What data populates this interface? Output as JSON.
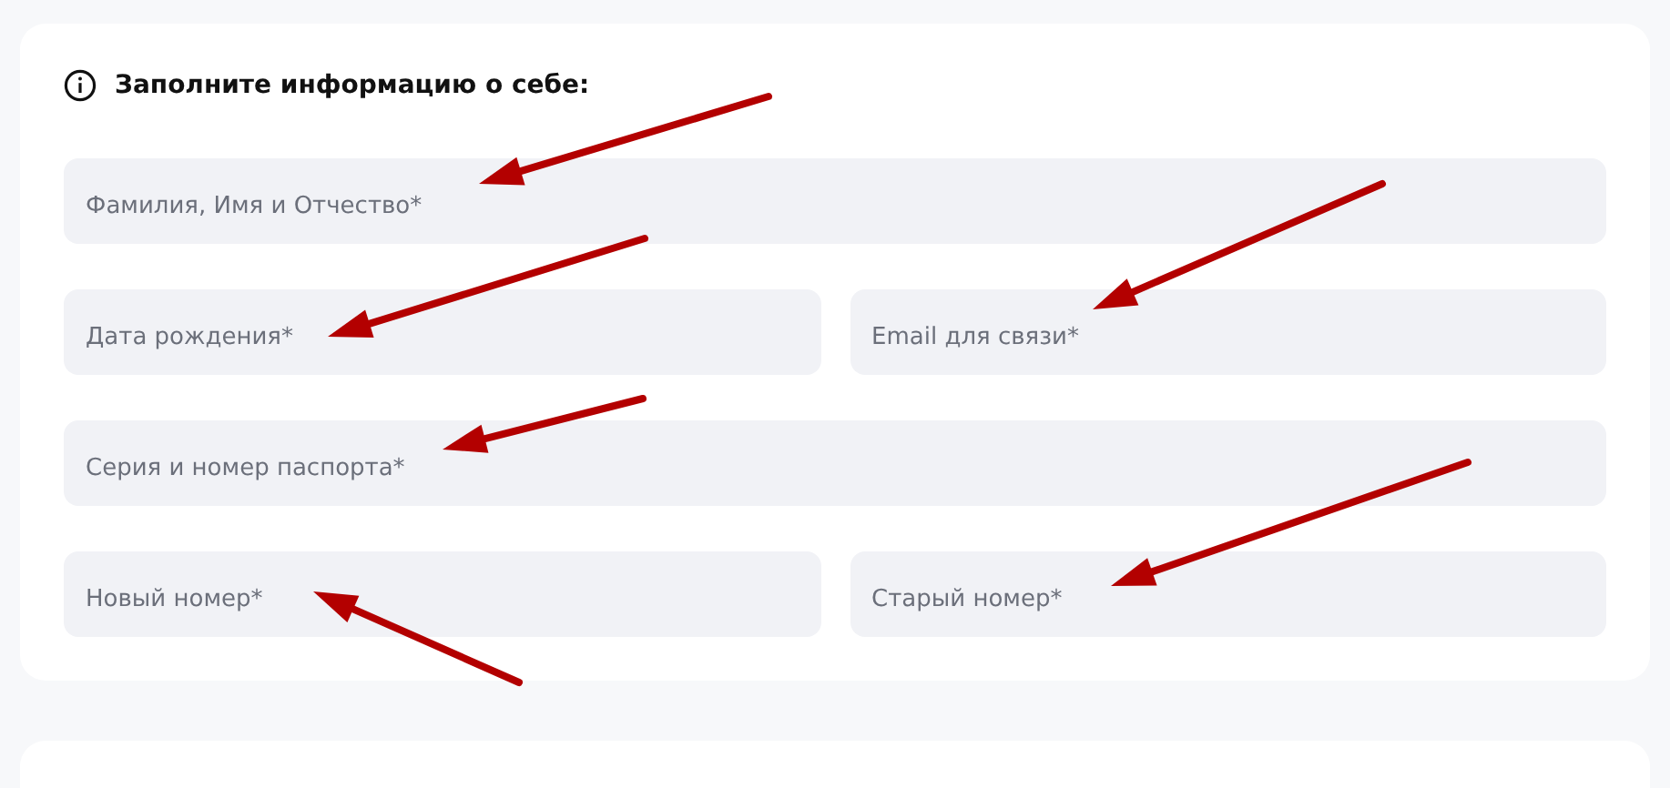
{
  "form": {
    "heading": "Заполните информацию о себе:",
    "fields": [
      {
        "kind": "full",
        "placeholder": "Фамилия, Имя и Отчество*"
      },
      {
        "kind": "half",
        "placeholder": "Дата рождения*"
      },
      {
        "kind": "half",
        "placeholder": "Email для связи*"
      },
      {
        "kind": "full",
        "placeholder": "Серия и номер паспорта*"
      },
      {
        "kind": "half",
        "placeholder": "Новый номер*"
      },
      {
        "kind": "half",
        "placeholder": "Старый номер*"
      }
    ]
  }
}
